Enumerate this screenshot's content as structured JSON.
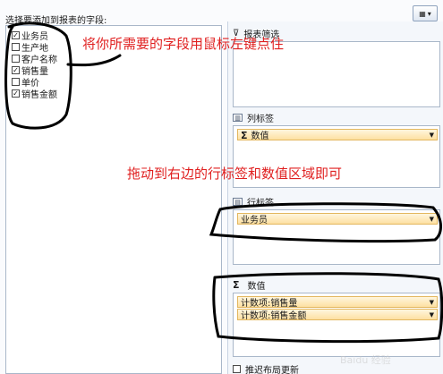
{
  "field_list": {
    "caption": "选择要添加到报表的字段:",
    "fields": [
      {
        "label": "业务员",
        "checked": true
      },
      {
        "label": "生产地",
        "checked": false
      },
      {
        "label": "客户名称",
        "checked": false
      },
      {
        "label": "销售量",
        "checked": true
      },
      {
        "label": "单价",
        "checked": false
      },
      {
        "label": "销售金额",
        "checked": true
      }
    ]
  },
  "zones": {
    "report_filter": {
      "title": "报表筛选"
    },
    "column_labels": {
      "title": "列标签",
      "items": [
        "数值"
      ]
    },
    "row_labels": {
      "title": "行标签",
      "items": [
        "业务员"
      ]
    },
    "values": {
      "title": "数值",
      "items": [
        "计数项:销售量",
        "计数项:销售金额"
      ]
    }
  },
  "defer_update": {
    "label": "推迟布局更新",
    "checked": false
  },
  "annotations": {
    "select_hint": "将你所需要的字段用鼠标左键点住",
    "drag_hint": "拖动到右边的行标签和数值区域即可"
  },
  "icons": {
    "layout": "layout-button-icon",
    "filter": "filter-icon",
    "column": "column-labels-icon",
    "row": "row-labels-icon",
    "sigma": "sigma-icon",
    "dropdown": "dropdown-arrow-icon"
  },
  "colors": {
    "annotation": "#e02020",
    "pen": "#000000",
    "item_fill": "#fde0a2"
  }
}
